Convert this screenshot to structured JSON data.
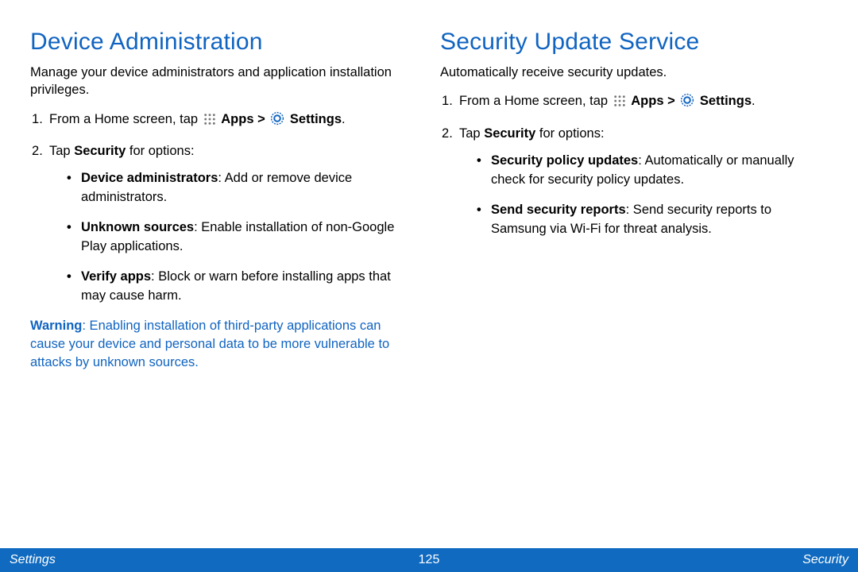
{
  "left": {
    "heading": "Device Administration",
    "intro": "Manage your device administrators and application installation privileges.",
    "step1_pre": "From a Home screen, tap ",
    "step1_apps": "Apps",
    "step1_gt": " > ",
    "step1_settings": "Settings",
    "step1_end": ".",
    "step2_pre": "Tap ",
    "step2_bold": "Security",
    "step2_post": " for options:",
    "b1_bold": "Device administrators",
    "b1_rest": ": Add or remove device administrators.",
    "b2_bold": "Unknown sources",
    "b2_rest": ": Enable installation of non‑Google Play applications.",
    "b3_bold": "Verify apps",
    "b3_rest": ": Block or warn before installing apps that may cause harm.",
    "warn_bold": "Warning",
    "warn_rest": ": Enabling installation of third-party applications can cause your device and personal data to be more vulnerable to attacks by unknown sources."
  },
  "right": {
    "heading": "Security Update Service",
    "intro": "Automatically receive security updates.",
    "step1_pre": "From a Home screen, tap ",
    "step1_apps": "Apps",
    "step1_gt": " > ",
    "step1_settings": "Settings",
    "step1_end": ".",
    "step2_pre": "Tap ",
    "step2_bold": "Security",
    "step2_post": " for options:",
    "b1_bold": "Security policy updates",
    "b1_rest": ": Automatically or manually check for security policy updates.",
    "b2_bold": "Send security reports",
    "b2_rest": ": Send security reports to Samsung via Wi‑Fi for threat analysis."
  },
  "footer": {
    "left": "Settings",
    "page": "125",
    "right": "Security"
  }
}
